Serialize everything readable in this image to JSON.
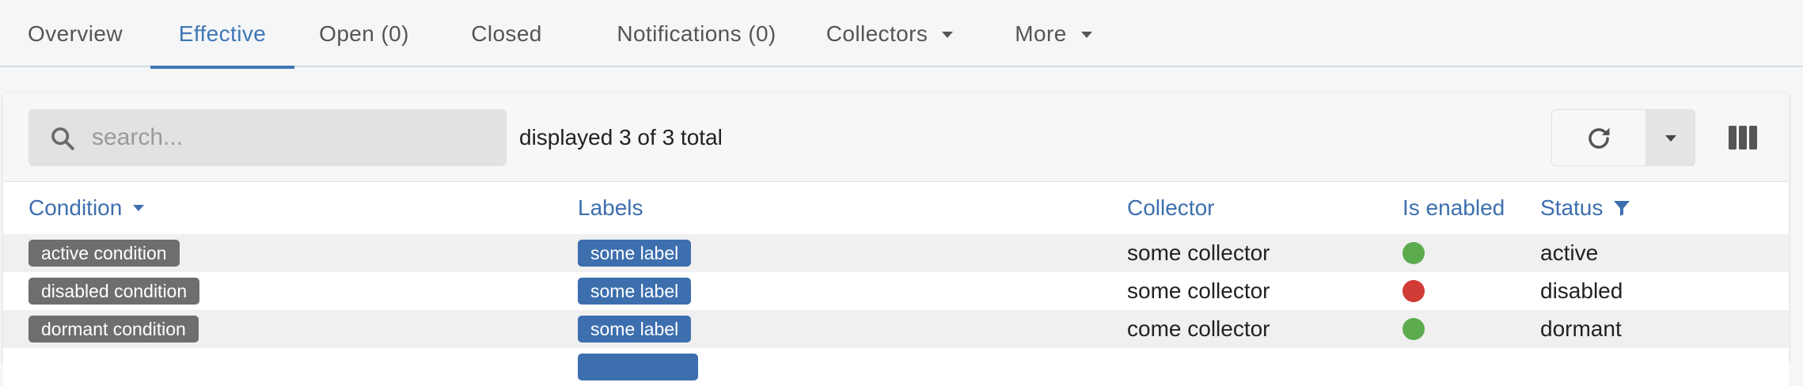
{
  "tabs": [
    {
      "label": "Overview",
      "active": false
    },
    {
      "label": "Effective",
      "active": true
    },
    {
      "label": "Open (0)",
      "active": false
    },
    {
      "label": "Closed",
      "active": false
    },
    {
      "label": "Notifications (0)",
      "active": false
    },
    {
      "label": "Collectors",
      "active": false,
      "dropdown": true
    },
    {
      "label": "More",
      "active": false,
      "dropdown": true
    }
  ],
  "toolbar": {
    "search_placeholder": "search...",
    "search_value": "",
    "count_text": "displayed 3 of 3 total",
    "icons": {
      "search": "search-icon",
      "refresh": "refresh-icon",
      "refresh_menu": "caret-down-icon",
      "columns": "columns-icon"
    }
  },
  "table": {
    "columns": [
      {
        "label": "Condition",
        "sort": "desc"
      },
      {
        "label": "Labels"
      },
      {
        "label": "Collector"
      },
      {
        "label": "Is enabled"
      },
      {
        "label": "Status",
        "filtered": true
      }
    ],
    "rows": [
      {
        "condition": "active condition",
        "label": "some label",
        "collector": "some collector",
        "enabled": true,
        "enabled_color": "#5cab4e",
        "status": "active"
      },
      {
        "condition": "disabled condition",
        "label": "some label",
        "collector": "some collector",
        "enabled": false,
        "enabled_color": "#d13b36",
        "status": "disabled"
      },
      {
        "condition": "dormant condition",
        "label": "some label",
        "collector": "come collector",
        "enabled": true,
        "enabled_color": "#5cab4e",
        "status": "dormant"
      }
    ]
  },
  "colors": {
    "accent": "#3d77b6",
    "header_text": "#3d6fae",
    "condition_tag": "#6e6e6e",
    "label_tag": "#3d6fae",
    "enabled": "#5cab4e",
    "disabled": "#d13b36"
  }
}
